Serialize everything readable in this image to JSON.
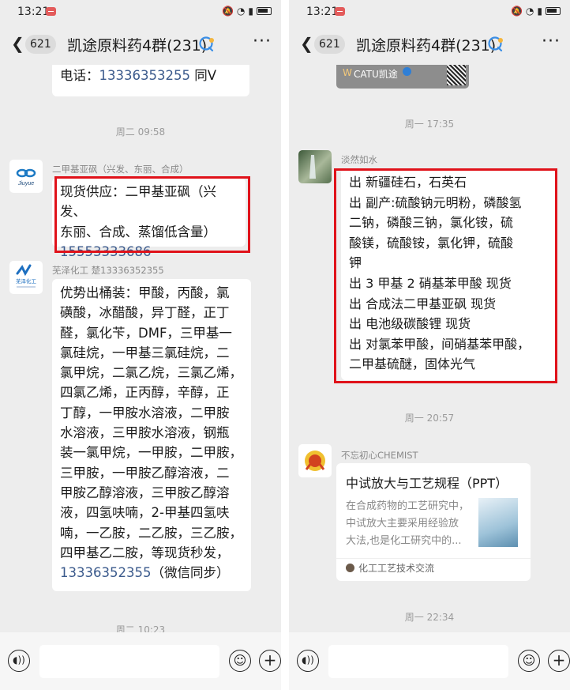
{
  "status_bar": {
    "time": "13:21",
    "icons": [
      "mute-icon",
      "wifi-icon",
      "sim-icon",
      "battery-icon"
    ]
  },
  "header": {
    "back_count": "621",
    "title": "凯途原料药4群(231)",
    "more": "···"
  },
  "left": {
    "partial_line": {
      "label": "电话：",
      "phone": "13336353255",
      "suffix": " 同V"
    },
    "ts1": "周二 09:58",
    "msg1": {
      "sender": "二甲基亚砜（兴发、东丽、合成）",
      "avatar_text": "Jiuyue",
      "lines": [
        "现货供应：二甲基亚砜（兴发、",
        "东丽、合成、蒸馏低含量）"
      ],
      "phone": "15553333686"
    },
    "msg2": {
      "sender": "芜泽化工 楚13336352355",
      "avatar_text": "芜泽化工",
      "lines": [
        "优势出桶装：甲酸，丙酸，氯",
        "磺酸，冰醋酸，异丁醛，正丁",
        "醛，氯化苄，DMF，三甲基一",
        "氯硅烷，一甲基三氯硅烷，二",
        "氯甲烷，二氯乙烷，三氯乙烯，",
        "四氯乙烯，正丙醇，辛醇，正",
        "丁醇，一甲胺水溶液，二甲胺",
        "水溶液，三甲胺水溶液，钢瓶",
        "装一氯甲烷，一甲胺，二甲胺，",
        "三甲胺，一甲胺乙醇溶液，二",
        "甲胺乙醇溶液，三甲胺乙醇溶",
        "液，四氢呋喃，2-甲基四氢呋",
        "喃，一乙胺，二乙胺，三乙胺，",
        "四甲基乙二胺，等现货秒发，"
      ],
      "phone": "13336352355",
      "phone_suffix": "（微信同步）"
    },
    "ts2": "周二 10:23"
  },
  "right": {
    "partial_card": {
      "brand": "CATU凯途"
    },
    "ts1": "周一 17:35",
    "msg1": {
      "sender": "淡然如水",
      "lines": [
        "出 新疆硅石，石英石",
        "出 副产:硫酸钠元明粉，磷酸氢",
        "二钠，磷酸三钠，氯化铵，硫",
        "酸镁，硫酸铵，氯化钾，硫酸",
        "钾",
        "出 3 甲基 2 硝基苯甲酸 现货",
        "出 合成法二甲基亚砜 现货",
        "出 电池级碳酸锂 现货",
        "出 对氯苯甲酸，间硝基苯甲酸，",
        "二甲基硫醚，固体光气"
      ]
    },
    "ts2": "周一 20:57",
    "msg2": {
      "sender": "不忘初心CHEMIST",
      "card_title": "中试放大与工艺规程（PPT）",
      "card_desc": [
        "在合成药物的工艺研究中，",
        "中试放大主要采用经验放",
        "大法,也是化工研究中的..."
      ],
      "card_source": "化工工艺技术交流"
    },
    "ts3": "周一 22:34"
  },
  "colors": {
    "bg": "#ededed",
    "bubble": "#ffffff",
    "link": "#3b5a8c",
    "highlight": "#e0121a"
  }
}
